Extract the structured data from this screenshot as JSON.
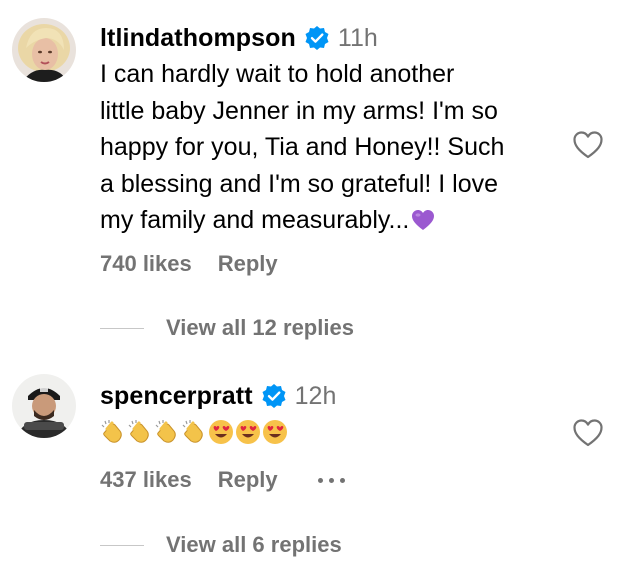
{
  "comments": [
    {
      "username": "ltlindathompson",
      "timestamp": "11h",
      "text": "I can hardly wait to hold another\nlittle baby Jenner in my arms! I'm so\nhappy for you, Tia and Honey!! Such\na blessing and I'm so grateful! I love\nmy family and measurably...",
      "trailing_emoji": "purple-heart",
      "likes": "740 likes",
      "reply_label": "Reply",
      "view_replies": "View all 12 replies"
    },
    {
      "username": "spencerpratt",
      "timestamp": "12h",
      "emojis": [
        "clapping-hands",
        "clapping-hands",
        "clapping-hands",
        "clapping-hands",
        "heart-eyes",
        "heart-eyes",
        "heart-eyes"
      ],
      "likes": "437 likes",
      "reply_label": "Reply",
      "view_replies": "View all 6 replies"
    }
  ],
  "colors": {
    "secondary_text": "#737373",
    "verified_blue": "#0095f6",
    "purple_heart": "#9b59d0",
    "divider": "#c7c7c7"
  },
  "icons": {
    "like": "heart-outline-icon",
    "verified": "verified-badge-icon",
    "more": "more-options-icon"
  }
}
